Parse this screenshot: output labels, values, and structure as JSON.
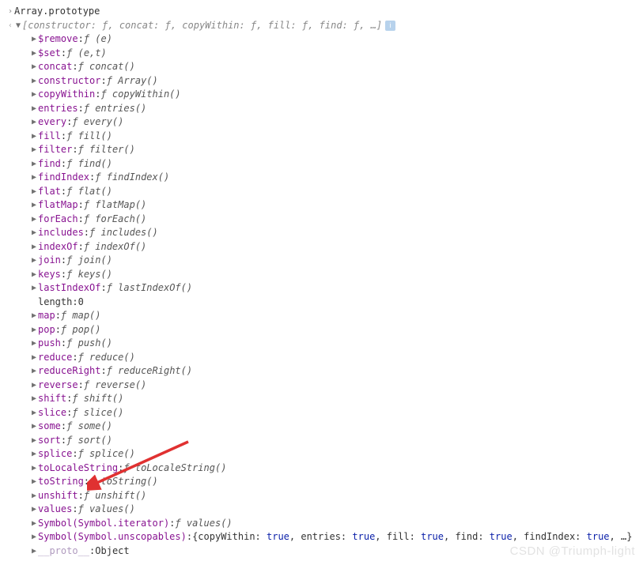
{
  "input_line": {
    "prompt": "›",
    "text": "Array.prototype"
  },
  "result_line": {
    "prompt": "‹",
    "preview": "[constructor: ƒ, concat: ƒ, copyWithin: ƒ, fill: ƒ, find: ƒ, …]"
  },
  "props": [
    {
      "k": "$remove",
      "v": "ƒ (e)"
    },
    {
      "k": "$set",
      "v": "ƒ (e,t)"
    },
    {
      "k": "concat",
      "v": "ƒ concat()"
    },
    {
      "k": "constructor",
      "v": "ƒ Array()"
    },
    {
      "k": "copyWithin",
      "v": "ƒ copyWithin()"
    },
    {
      "k": "entries",
      "v": "ƒ entries()"
    },
    {
      "k": "every",
      "v": "ƒ every()"
    },
    {
      "k": "fill",
      "v": "ƒ fill()"
    },
    {
      "k": "filter",
      "v": "ƒ filter()"
    },
    {
      "k": "find",
      "v": "ƒ find()"
    },
    {
      "k": "findIndex",
      "v": "ƒ findIndex()"
    },
    {
      "k": "flat",
      "v": "ƒ flat()"
    },
    {
      "k": "flatMap",
      "v": "ƒ flatMap()"
    },
    {
      "k": "forEach",
      "v": "ƒ forEach()"
    },
    {
      "k": "includes",
      "v": "ƒ includes()"
    },
    {
      "k": "indexOf",
      "v": "ƒ indexOf()"
    },
    {
      "k": "join",
      "v": "ƒ join()"
    },
    {
      "k": "keys",
      "v": "ƒ keys()"
    },
    {
      "k": "lastIndexOf",
      "v": "ƒ lastIndexOf()"
    },
    {
      "k": "length",
      "v": "0",
      "plain": true,
      "noCaret": true
    },
    {
      "k": "map",
      "v": "ƒ map()"
    },
    {
      "k": "pop",
      "v": "ƒ pop()"
    },
    {
      "k": "push",
      "v": "ƒ push()"
    },
    {
      "k": "reduce",
      "v": "ƒ reduce()"
    },
    {
      "k": "reduceRight",
      "v": "ƒ reduceRight()"
    },
    {
      "k": "reverse",
      "v": "ƒ reverse()"
    },
    {
      "k": "shift",
      "v": "ƒ shift()"
    },
    {
      "k": "slice",
      "v": "ƒ slice()"
    },
    {
      "k": "some",
      "v": "ƒ some()"
    },
    {
      "k": "sort",
      "v": "ƒ sort()"
    },
    {
      "k": "splice",
      "v": "ƒ splice()"
    },
    {
      "k": "toLocaleString",
      "v": "ƒ toLocaleString()"
    },
    {
      "k": "toString",
      "v": "ƒ toString()"
    },
    {
      "k": "unshift",
      "v": "ƒ unshift()"
    },
    {
      "k": "values",
      "v": "ƒ values()"
    },
    {
      "k": "Symbol(Symbol.iterator)",
      "v": "ƒ values()"
    }
  ],
  "unscopables": {
    "key": "Symbol(Symbol.unscopables)",
    "prefix": "{copyWithin: ",
    "parts": [
      {
        "label": "true",
        "after": ", entries: "
      },
      {
        "label": "true",
        "after": ", fill: "
      },
      {
        "label": "true",
        "after": ", find: "
      },
      {
        "label": "true",
        "after": ", findIndex: "
      },
      {
        "label": "true",
        "after": ", …}"
      }
    ]
  },
  "proto": {
    "key": "__proto__",
    "v": "Object"
  },
  "watermark": "CSDN @Triumph-light"
}
